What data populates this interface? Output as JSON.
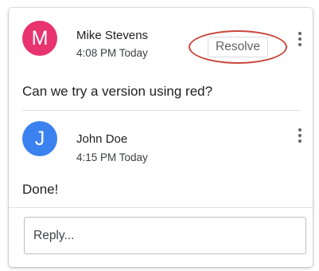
{
  "colors": {
    "avatar_mike": "#e8336f",
    "avatar_john": "#3b82f0",
    "annotation_circle": "#c8473c"
  },
  "comments": [
    {
      "avatar_letter": "M",
      "author": "Mike Stevens",
      "time": "4:08 PM Today",
      "text": "Can we try a version using red?",
      "resolve_label": "Resolve",
      "menu_icon": "more-vert-icon"
    },
    {
      "avatar_letter": "J",
      "author": "John Doe",
      "time": "4:15 PM Today",
      "text": "Done!",
      "menu_icon": "more-vert-icon"
    }
  ],
  "reply": {
    "placeholder": "Reply..."
  }
}
